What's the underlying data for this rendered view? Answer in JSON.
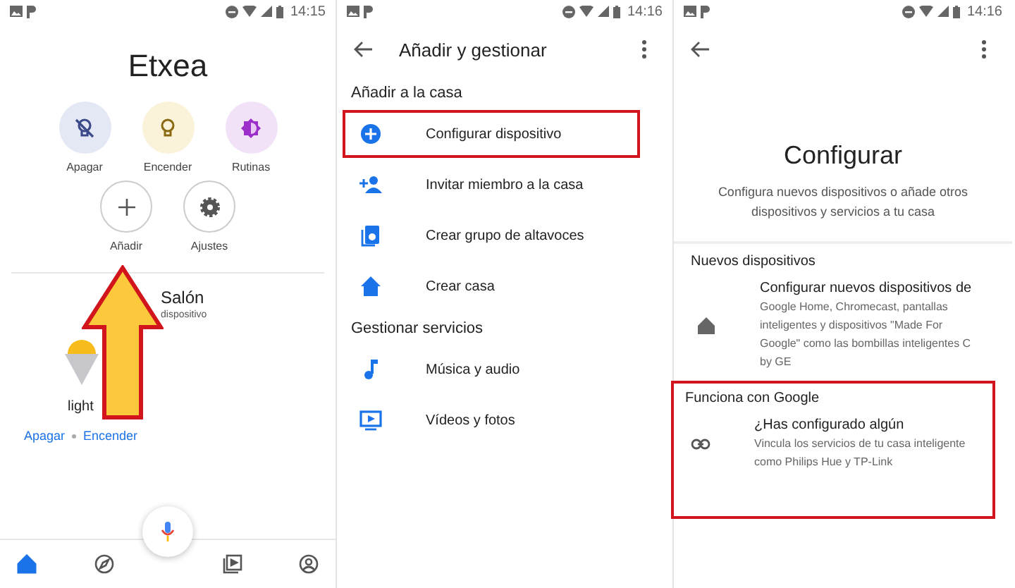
{
  "home_screen": {
    "status_bar": {
      "time": "14:15"
    },
    "title": "Etxea",
    "actions": [
      {
        "kind": "off",
        "label": "Apagar"
      },
      {
        "kind": "on",
        "label": "Encender"
      },
      {
        "kind": "routines",
        "label": "Rutinas"
      },
      {
        "kind": "add",
        "label": "Añadir"
      },
      {
        "kind": "settings",
        "label": "Ajustes"
      }
    ],
    "room": {
      "name": "Salón",
      "subtitle": "dispositivo"
    },
    "device": {
      "name": "light",
      "links": [
        "Apagar",
        "Encender"
      ]
    },
    "bottom_nav": [
      {
        "kind": "home",
        "selected": true
      },
      {
        "kind": "discover",
        "selected": false
      },
      {
        "kind": "media",
        "selected": false
      },
      {
        "kind": "account",
        "selected": false
      }
    ]
  },
  "add_manage_screen": {
    "status_bar": {
      "time": "14:16"
    },
    "title": "Añadir y gestionar",
    "sections": [
      {
        "heading": "Añadir a la casa",
        "items": [
          {
            "kind": "add",
            "label": "Configurar dispositivo",
            "highlighted": true
          },
          {
            "kind": "invite",
            "label": "Invitar miembro a la casa",
            "highlighted": false
          },
          {
            "kind": "speaker",
            "label": "Crear grupo de altavoces",
            "highlighted": false
          },
          {
            "kind": "home",
            "label": "Crear casa",
            "highlighted": false
          }
        ]
      },
      {
        "heading": "Gestionar servicios",
        "items": [
          {
            "kind": "music",
            "label": "Música y audio",
            "highlighted": false
          },
          {
            "kind": "video",
            "label": "Vídeos y fotos",
            "highlighted": false
          }
        ]
      }
    ]
  },
  "configure_screen": {
    "status_bar": {
      "time": "14:16"
    },
    "title": "Configurar",
    "description": "Configura nuevos dispositivos o añade otros dispositivos y servicios a tu casa",
    "sections": [
      {
        "heading": "Nuevos dispositivos",
        "highlighted": false,
        "item": {
          "kind": "home",
          "title": "Configurar nuevos dispositivos de",
          "body": "Google Home, Chromecast, pantallas inteligentes y dispositivos \"Made For Google\" como las bombillas inteligentes C by GE"
        }
      },
      {
        "heading": "Funciona con Google",
        "highlighted": true,
        "item": {
          "kind": "link",
          "title": "¿Has configurado algún",
          "body": "Vincula los servicios de tu casa inteligente como Philips Hue y TP-Link"
        }
      }
    ]
  }
}
